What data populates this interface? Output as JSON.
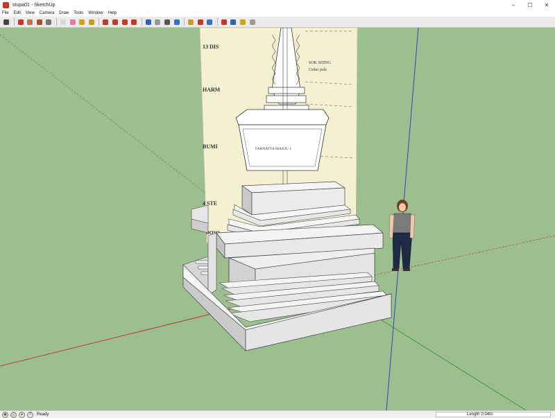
{
  "window": {
    "title": "stupa01 - SketchUp",
    "controls": [
      "–",
      "☐",
      "✕"
    ]
  },
  "menu": [
    {
      "label": "File"
    },
    {
      "label": "Edit"
    },
    {
      "label": "View"
    },
    {
      "label": "Camera"
    },
    {
      "label": "Draw"
    },
    {
      "label": "Tools"
    },
    {
      "label": "Window"
    },
    {
      "label": "Help"
    }
  ],
  "toolbar": {
    "groups": [
      [
        {
          "name": "select-tool-icon",
          "color": "#444444"
        }
      ],
      [
        {
          "name": "line-tool-icon",
          "color": "#c0392b"
        },
        {
          "name": "rectangle-tool-icon",
          "color": "#b5794a"
        },
        {
          "name": "circle-tool-icon",
          "color": "#a0522d"
        },
        {
          "name": "arc-tool-icon",
          "color": "#777777"
        }
      ],
      [
        {
          "name": "make-component-icon",
          "color": "#d8d8d8"
        },
        {
          "name": "eraser-tool-icon",
          "color": "#e07aa8"
        },
        {
          "name": "tape-measure-tool-icon",
          "color": "#d4a017"
        },
        {
          "name": "paint-bucket-tool-icon",
          "color": "#c79a2b"
        }
      ],
      [
        {
          "name": "push-pull-tool-icon",
          "color": "#c0392b"
        },
        {
          "name": "move-tool-icon",
          "color": "#c0392b"
        },
        {
          "name": "rotate-tool-icon",
          "color": "#c0392b"
        },
        {
          "name": "offset-tool-icon",
          "color": "#c0392b"
        }
      ],
      [
        {
          "name": "orbit-tool-icon",
          "color": "#2e63b8"
        },
        {
          "name": "pan-tool-icon",
          "color": "#999999"
        },
        {
          "name": "zoom-tool-icon",
          "color": "#555555"
        },
        {
          "name": "zoom-extents-icon",
          "color": "#3a6fc4"
        }
      ],
      [
        {
          "name": "warehouse-icon",
          "color": "#c99b2e"
        },
        {
          "name": "extension-warehouse-icon",
          "color": "#c0392b"
        },
        {
          "name": "share-model-icon",
          "color": "#3a6fc4"
        }
      ],
      [
        {
          "name": "layout-icon",
          "color": "#c0392b"
        },
        {
          "name": "style-builder-icon",
          "color": "#2e63b8"
        },
        {
          "name": "extension-manager-icon",
          "color": "#d4a017"
        },
        {
          "name": "sketchup-ruby-icon",
          "color": "#9a9a9a"
        }
      ]
    ]
  },
  "drawing": {
    "labels": [
      "13 DIS",
      "HARM",
      "BUMI",
      "4 STE",
      "DOSO"
    ],
    "right_labels": [
      "SOK SHING",
      "Cedar pole"
    ],
    "vase_text": "FARNATTA MANJU 1"
  },
  "status": {
    "text": "Ready",
    "icons": [
      "geo-location-icon",
      "credits-icon",
      "user-icon"
    ]
  },
  "measurement": {
    "label": "Length",
    "value": "0.04m"
  },
  "colors": {
    "sky_ground": "#9dbf8f",
    "paper": "#f4f0d2",
    "axis_red": "#c0392b",
    "axis_green": "#3c9a3c",
    "axis_blue": "#2a44c8"
  }
}
